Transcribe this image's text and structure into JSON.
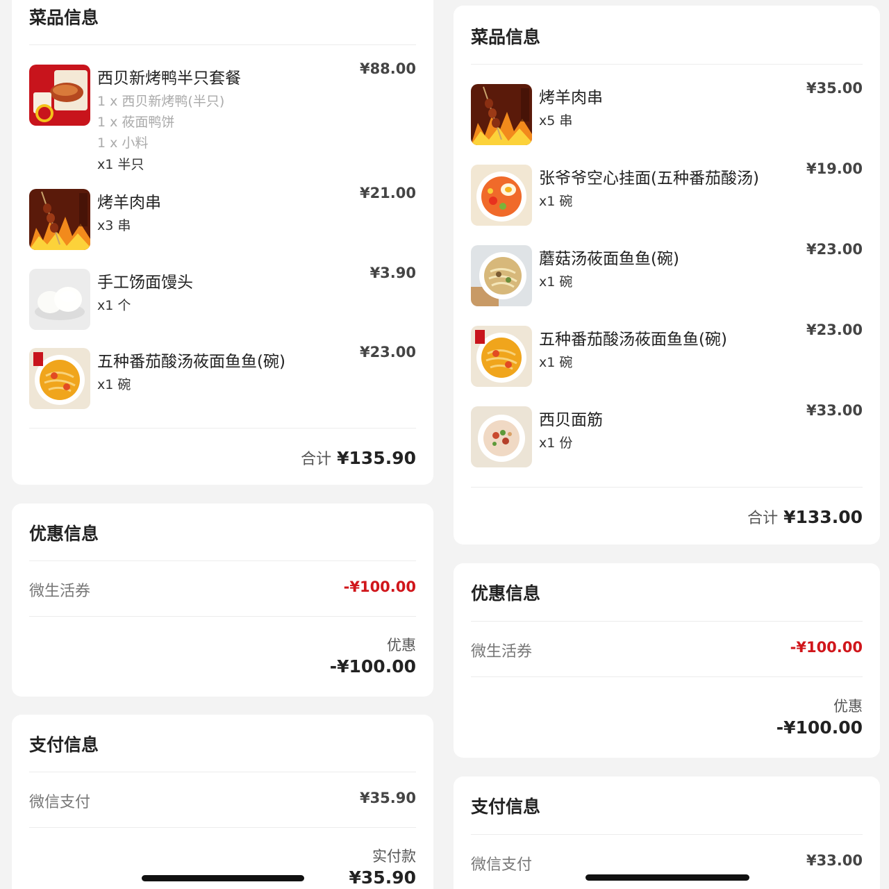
{
  "left": {
    "dishes": {
      "title": "菜品信息",
      "items": [
        {
          "name": "西贝新烤鸭半只套餐",
          "price": "¥88.00",
          "subs": [
            "1 x 西贝新烤鸭(半只)",
            "1 x 莜面鸭饼",
            "1 x 小料"
          ],
          "qty": "x1 半只",
          "icon": "roast-duck-image"
        },
        {
          "name": "烤羊肉串",
          "price": "¥21.00",
          "subs": [],
          "qty": "x3 串",
          "icon": "lamb-skewer-image"
        },
        {
          "name": "手工饧面馒头",
          "price": "¥3.90",
          "subs": [],
          "qty": "x1 个",
          "icon": "steamed-bun-image"
        },
        {
          "name": "五种番茄酸汤莜面鱼鱼(碗)",
          "price": "¥23.00",
          "subs": [],
          "qty": "x1 碗",
          "icon": "tomato-soup-image"
        }
      ],
      "total_label": "合计",
      "total_value": "¥135.90"
    },
    "discount": {
      "title": "优惠信息",
      "coupon_label": "微生活券",
      "coupon_value": "-¥100.00",
      "sum_label": "优惠",
      "sum_value": "-¥100.00"
    },
    "payment": {
      "title": "支付信息",
      "method_label": "微信支付",
      "method_value": "¥35.90",
      "sum_label": "实付款",
      "sum_value": "¥35.90"
    }
  },
  "right": {
    "dishes": {
      "title": "菜品信息",
      "items": [
        {
          "name": "烤羊肉串",
          "price": "¥35.00",
          "qty": "x5 串",
          "icon": "lamb-skewer-image"
        },
        {
          "name": "张爷爷空心挂面(五种番茄酸汤)",
          "price": "¥19.00",
          "qty": "x1 碗",
          "icon": "tomato-noodle-image"
        },
        {
          "name": "蘑菇汤莜面鱼鱼(碗)",
          "price": "¥23.00",
          "qty": "x1 碗",
          "icon": "mushroom-soup-image"
        },
        {
          "name": "五种番茄酸汤莜面鱼鱼(碗)",
          "price": "¥23.00",
          "qty": "x1 碗",
          "icon": "tomato-soup-image"
        },
        {
          "name": "西贝面筋",
          "price": "¥33.00",
          "qty": "x1 份",
          "icon": "gluten-image"
        }
      ],
      "total_label": "合计",
      "total_value": "¥133.00"
    },
    "discount": {
      "title": "优惠信息",
      "coupon_label": "微生活券",
      "coupon_value": "-¥100.00",
      "sum_label": "优惠",
      "sum_value": "-¥100.00"
    },
    "payment": {
      "title": "支付信息",
      "method_label": "微信支付",
      "method_value": "¥33.00"
    }
  },
  "colors": {
    "accent_red": "#d0161b",
    "background": "#f3f3f3",
    "card": "#ffffff"
  }
}
